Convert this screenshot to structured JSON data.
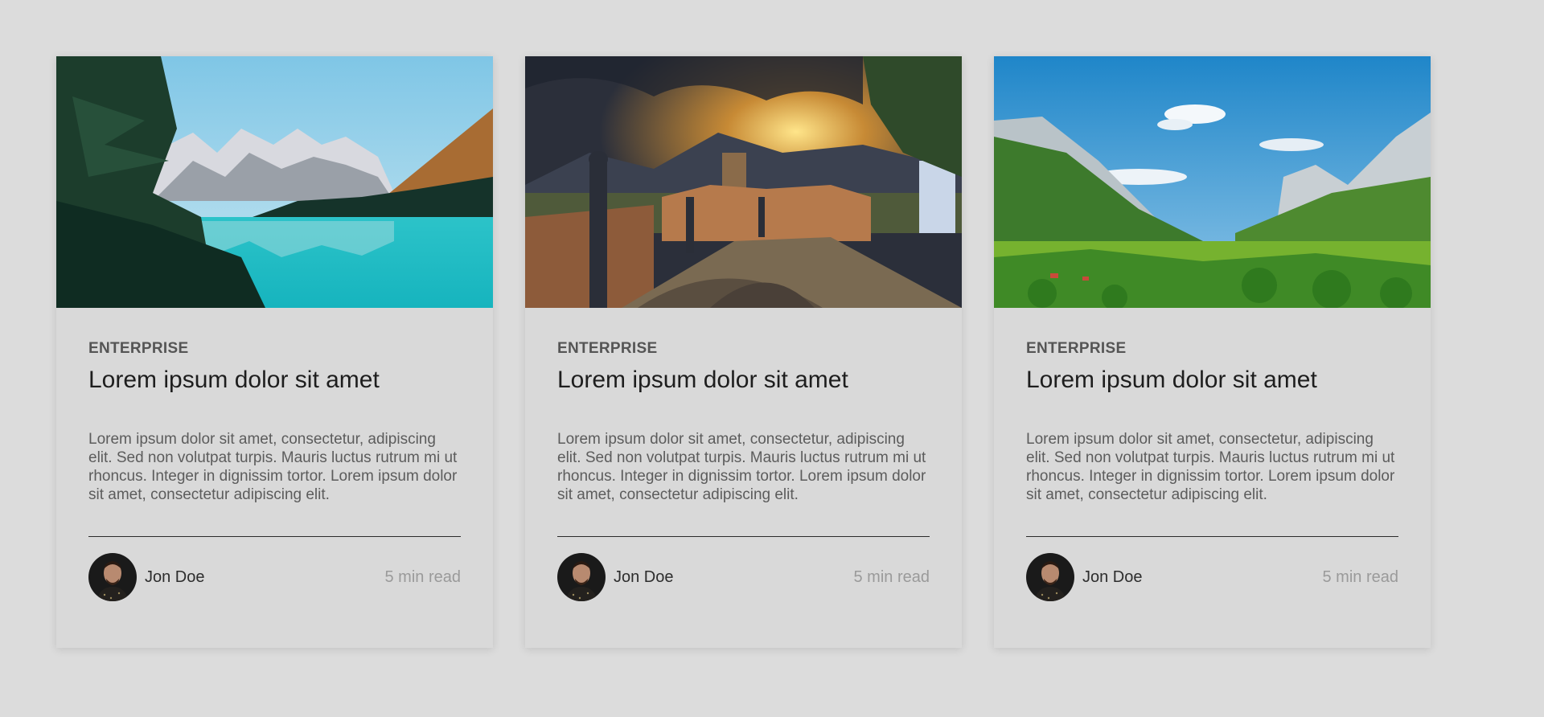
{
  "cards": [
    {
      "image_subject": "mountain lake with pine trees",
      "category": "ENTERPRISE",
      "title": "Lorem ipsum dolor sit amet",
      "excerpt": "Lorem ipsum dolor sit amet, consectetur, adipiscing elit. Sed non volutpat turpis. Mauris luctus rutrum mi ut rhoncus. Integer in dignissim tortor. Lorem ipsum dolor sit amet, consectetur adipiscing elit.",
      "author": "Jon Doe",
      "read_time": "5 min read"
    },
    {
      "image_subject": "cobblestone village street at sunset",
      "category": "ENTERPRISE",
      "title": "Lorem ipsum dolor sit amet",
      "excerpt": "Lorem ipsum dolor sit amet, consectetur, adipiscing elit. Sed non volutpat turpis. Mauris luctus rutrum mi ut rhoncus. Integer in dignissim tortor. Lorem ipsum dolor sit amet, consectetur adipiscing elit.",
      "author": "Jon Doe",
      "read_time": "5 min read"
    },
    {
      "image_subject": "green alpine valley with blue sky",
      "category": "ENTERPRISE",
      "title": "Lorem ipsum dolor sit amet",
      "excerpt": "Lorem ipsum dolor sit amet, consectetur, adipiscing elit. Sed non volutpat turpis. Mauris luctus rutrum mi ut rhoncus. Integer in dignissim tortor. Lorem ipsum dolor sit amet, consectetur adipiscing elit.",
      "author": "Jon Doe",
      "read_time": "5 min read"
    }
  ],
  "colors": {
    "page_background": "#dcdcdc",
    "card_background": "#d9d9d9",
    "category_text": "#555555",
    "title_text": "#1e1e1e",
    "excerpt_text": "#5c5c5c",
    "read_time_text": "#9a9a9a"
  }
}
